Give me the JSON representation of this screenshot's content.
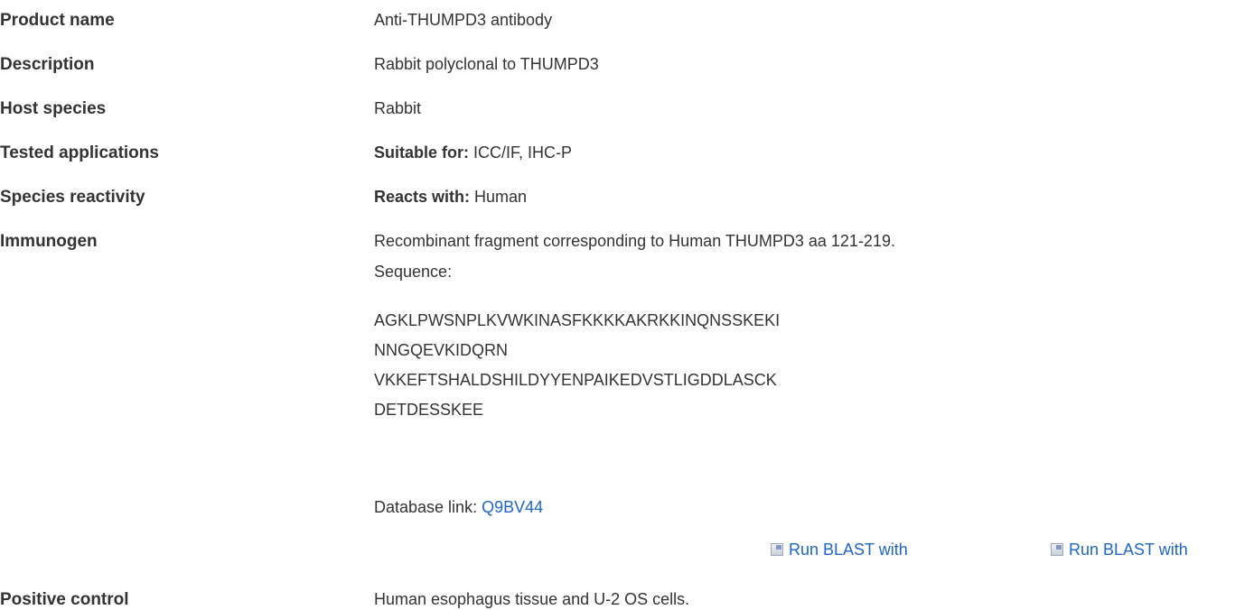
{
  "rows": {
    "product_name": {
      "label": "Product name",
      "value": "Anti-THUMPD3 antibody"
    },
    "description": {
      "label": "Description",
      "value": "Rabbit polyclonal to THUMPD3"
    },
    "host_species": {
      "label": "Host species",
      "value": "Rabbit"
    },
    "tested_applications": {
      "label": "Tested applications",
      "prefix": "Suitable for:",
      "value": " ICC/IF, IHC-P"
    },
    "species_reactivity": {
      "label": "Species reactivity",
      "prefix": "Reacts with:",
      "value": " Human"
    },
    "immunogen": {
      "label": "Immunogen",
      "value": "Recombinant fragment corresponding to Human THUMPD3 aa 121-219.",
      "sequence_label": "Sequence:",
      "sequence_lines": [
        "AGKLPWSNPLKVWKINASFKKKKAKRKKINQNSSKEKI",
        "NNGQEVKIDQRN",
        "VKKEFTSHALDSHILDYYENPAIKEDVSTLIGDDLASCK",
        "DETDESSKEE"
      ],
      "database_link_label": "Database link: ",
      "database_link": "Q9BV44",
      "blast_links": [
        "Run BLAST with",
        "Run BLAST with"
      ]
    },
    "positive_control": {
      "label": "Positive control",
      "value": "Human esophagus tissue and U-2 OS cells."
    }
  }
}
